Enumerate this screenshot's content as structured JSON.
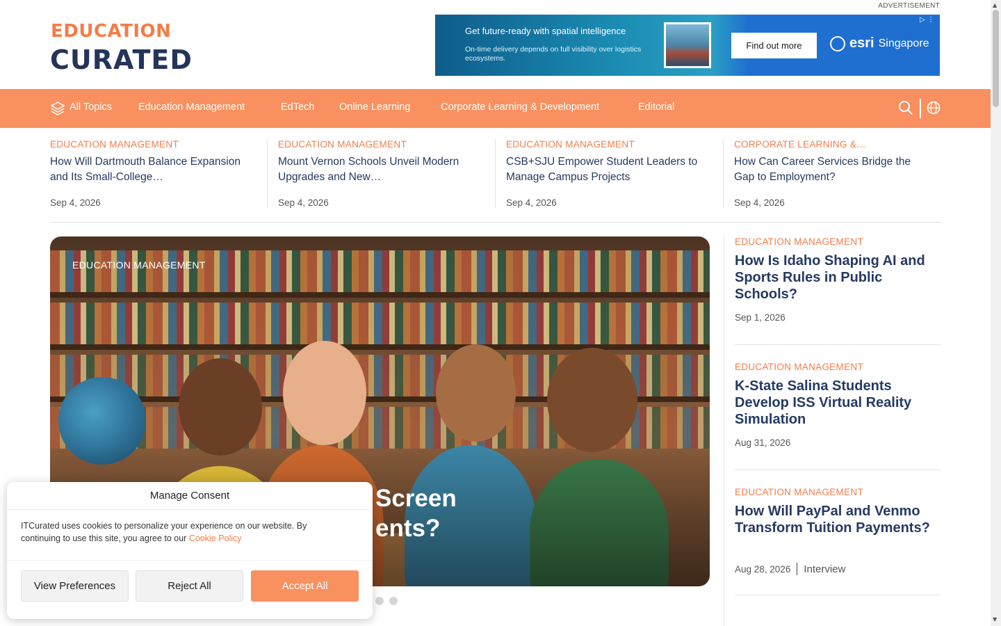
{
  "header": {
    "logo_top": "EDUCATION",
    "logo_bottom": "CURATED",
    "ad_label": "ADVERTISEMENT",
    "ad": {
      "headline": "Get future-ready with spatial intelligence",
      "sub": "On-time delivery depends on full visibility over logistics ecosystems.",
      "cta": "Find out more",
      "brand": "esri",
      "region": "Singapore"
    }
  },
  "nav": {
    "items": [
      "All Topics",
      "Education Management",
      "EdTech",
      "Online Learning",
      "Corporate Learning & Development",
      "Editorial"
    ],
    "icons": [
      "layers-icon",
      "search-icon",
      "globe-icon"
    ]
  },
  "strip": [
    {
      "kicker": "EDUCATION MANAGEMENT",
      "title": "How Will Dartmouth Balance Expansion and Its Small-College…",
      "date": "Sep 4, 2026"
    },
    {
      "kicker": "EDUCATION MANAGEMENT",
      "title": "Mount Vernon Schools Unveil Modern Upgrades and New…",
      "date": "Sep 4, 2026"
    },
    {
      "kicker": "EDUCATION MANAGEMENT",
      "title": "CSB+SJU Empower Student Leaders to Manage Campus Projects",
      "date": "Sep 4, 2026"
    },
    {
      "kicker": "CORPORATE LEARNING &…",
      "title": "How Can Career Services Bridge the Gap to Employment?",
      "date": "Sep 4, 2026"
    }
  ],
  "hero": {
    "kicker": "EDUCATION MANAGEMENT",
    "title_line1": "Screen",
    "title_line2": "ents?"
  },
  "sidebar": [
    {
      "kicker": "EDUCATION MANAGEMENT",
      "title": "How Is Idaho Shaping AI and Sports Rules in Public Schools?",
      "date": "Sep 1, 2026",
      "tag": ""
    },
    {
      "kicker": "EDUCATION MANAGEMENT",
      "title": "K-State Salina Students Develop ISS Virtual Reality Simulation",
      "date": "Aug 31, 2026",
      "tag": ""
    },
    {
      "kicker": "EDUCATION MANAGEMENT",
      "title": "How Will PayPal and Venmo Transform Tuition Payments?",
      "date": "Aug 28, 2026",
      "tag": "Interview"
    }
  ],
  "consent": {
    "title": "Manage Consent",
    "body": "ITCurated uses cookies to personalize your experience on our website. By continuing to use this site, you agree to our",
    "link": "Cookie Policy",
    "buttons": {
      "prefs": "View Preferences",
      "reject": "Reject All",
      "accept": "Accept All"
    }
  },
  "colors": {
    "accent": "#f8915f",
    "kicker": "#f47c48",
    "navy": "#243a63"
  }
}
